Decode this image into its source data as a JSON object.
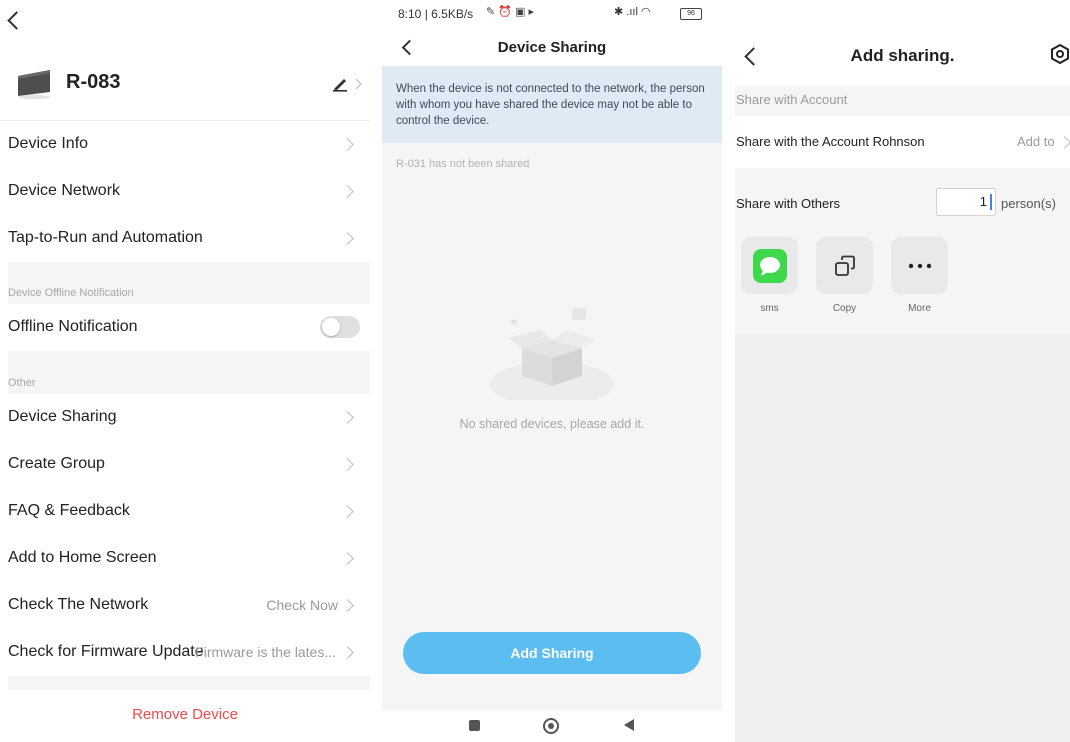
{
  "settings": {
    "device_name": "R-083",
    "items": [
      {
        "label": "Device Info"
      },
      {
        "label": "Device Network"
      },
      {
        "label": "Tap-to-Run and Automation"
      }
    ],
    "offline_section": "Device Offline Notification",
    "offline_label": "Offline Notification",
    "offline_enabled": false,
    "other_section": "Other",
    "other_items": [
      {
        "label": "Device Sharing",
        "value": ""
      },
      {
        "label": "Create Group",
        "value": ""
      },
      {
        "label": "FAQ & Feedback",
        "value": ""
      },
      {
        "label": "Add to Home Screen",
        "value": ""
      },
      {
        "label": "Check The Network",
        "value": "Check Now"
      },
      {
        "label": "Check for Firmware Update",
        "value": "Firmware is the lates..."
      }
    ],
    "remove_label": "Remove Device"
  },
  "sharing": {
    "status_time": "8:10 | 6.5KB/s",
    "battery": "96",
    "title": "Device Sharing",
    "notice": "When the device is not connected to the network, the person with whom you have shared the device may not be able to control the device.",
    "not_shared": "R-031 has not been shared",
    "empty_text": "No shared devices, please add it.",
    "add_button": "Add Sharing"
  },
  "add_sharing": {
    "title": "Add sharing.",
    "account_header": "Share with Account",
    "account_row": "Share with the Account Rohnson",
    "add_to": "Add to",
    "others_label": "Share with Others",
    "person_count": "1",
    "person_unit": "person(s)",
    "apps": [
      {
        "label": "sms",
        "icon": "message-bubble"
      },
      {
        "label": "Copy",
        "icon": "copy"
      },
      {
        "label": "More",
        "icon": "more-dots"
      }
    ],
    "colors": {
      "sms_green": "#3ed84a",
      "accent_blue": "#5cbdf0",
      "remove_red": "#f04a4a"
    }
  }
}
